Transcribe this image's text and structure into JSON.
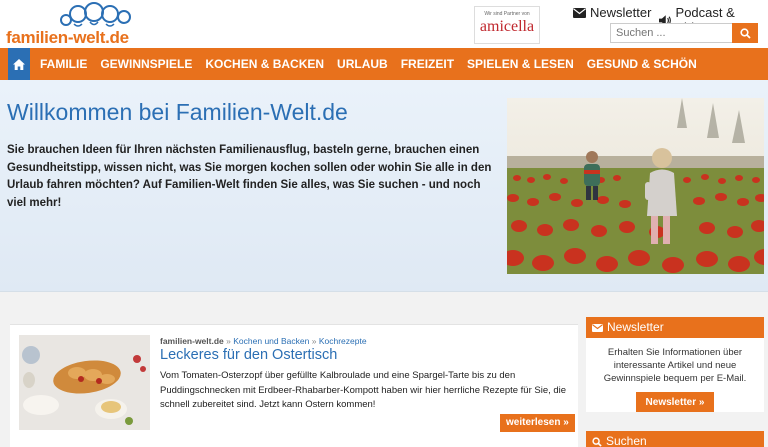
{
  "header": {
    "logo_text": "familien-welt.de",
    "partner_label": "Wir sind Partner von",
    "partner_brand": "amicella",
    "newsletter_link": "Newsletter",
    "podcast_link": "Podcast & Video",
    "search_placeholder": "Suchen ..."
  },
  "nav": {
    "items": [
      "FAMILIE",
      "GEWINNSPIELE",
      "KOCHEN & BACKEN",
      "URLAUB",
      "FREIZEIT",
      "SPIELEN & LESEN",
      "GESUND & SCHÖN"
    ]
  },
  "hero": {
    "title": "Willkommen bei Familien-Welt.de",
    "text": "Sie brauchen Ideen für Ihren nächsten Familienausflug, basteln gerne, brauchen einen Gesundheitstipp, wissen nicht, was Sie morgen kochen sollen oder wohin Sie alle in den Urlaub fahren möchten? Auf Familien-Welt finden Sie alles, was Sie suchen - und noch viel mehr!"
  },
  "article": {
    "crumb_site": "familien-welt.de",
    "crumb_sep": "»",
    "crumb_cat": "Kochen und Backen",
    "crumb_sub": "Kochrezepte",
    "title": "Leckeres für den Ostertisch",
    "text": "Vom Tomaten-Osterzopf über gefüllte Kalbroulade und eine Spargel-Tarte bis zu den Puddingschnecken mit Erdbeer-Rhabarber-Kompott haben wir hier herrliche Rezepte für Sie, die schnell zubereitet sind. Jetzt kann Ostern kommen!",
    "read_more": "weiterlesen »"
  },
  "sidebar": {
    "newsletter_title": "Newsletter",
    "newsletter_text": "Erhalten Sie Informationen über interessante Artikel und neue Gewinnspiele bequem per E-Mail.",
    "newsletter_button": "Newsletter »",
    "search_title": "Suchen"
  },
  "colors": {
    "accent": "#e8711c",
    "link": "#2b6fb4",
    "home": "#2b6fb4"
  },
  "icons": [
    "home-icon",
    "envelope-icon",
    "speaker-icon",
    "search-icon"
  ]
}
